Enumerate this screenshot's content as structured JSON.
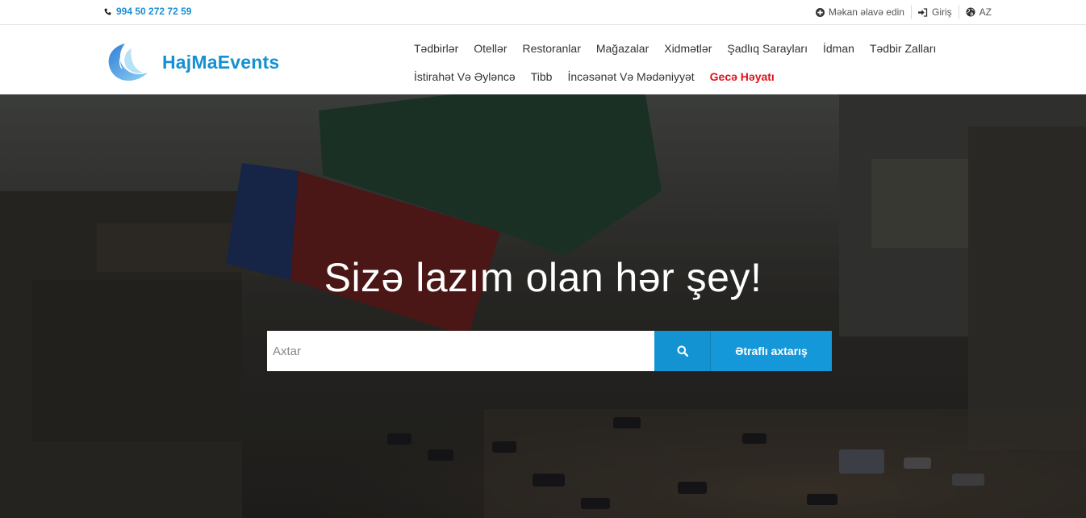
{
  "topbar": {
    "phone": "994 50 272 72 59",
    "links": [
      {
        "label": "Məkan əlavə edin",
        "icon": "plus-circle-icon"
      },
      {
        "label": "Giriş",
        "icon": "sign-in-icon"
      },
      {
        "label": "AZ",
        "icon": "globe-icon"
      }
    ]
  },
  "header": {
    "logo_text": "HajMaEvents",
    "nav_row1": [
      "Tədbirlər",
      "Otellər",
      "Restoranlar",
      "Mağazalar",
      "Xidmətlər",
      "Şadlıq Sarayları",
      "İdman",
      "Tədbir Zalları"
    ],
    "nav_row2": [
      "İstirahət Və Əyləncə",
      "Tibb",
      "İncəsənət Və Mədəniyyət"
    ],
    "nav_highlight": "Gecə Həyatı"
  },
  "hero": {
    "title": "Sizə lazım olan hər şey!",
    "search_placeholder": "Axtar",
    "advanced_search_label": "Ətraflı axtarış"
  },
  "colors": {
    "accent": "#1598da",
    "brand": "#1590d2",
    "highlight": "#e0101b"
  }
}
